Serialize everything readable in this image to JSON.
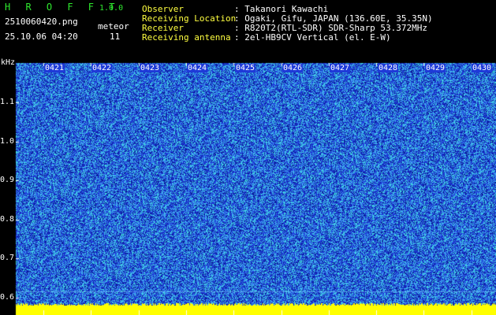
{
  "header": {
    "logo": "H R O F F T",
    "version": "1.0.0",
    "filename": "2510060420.png",
    "datetime": "25.10.06 04:20",
    "meteor_label": "meteor",
    "meteor_count": "11"
  },
  "info": {
    "observer_label": "Observer",
    "observer_value": ": Takanori Kawachi",
    "location_label": "Receiving Location",
    "location_value": ": Ogaki, Gifu, JAPAN (136.60E, 35.35N)",
    "receiver_label": "Receiver",
    "receiver_value": ": R820T2(RTL-SDR) SDR-Sharp 53.372MHz",
    "antenna_label": "Receiving antenna",
    "antenna_value": ": 2el-HB9CV Vertical (el. E-W)"
  },
  "axis": {
    "unit": "kHz",
    "y_ticks": [
      "1.1",
      "1.0",
      "0.9",
      "0.8",
      "0.7",
      "0.6"
    ],
    "y_values": [
      1.1,
      1.0,
      0.9,
      0.8,
      0.7,
      0.6
    ],
    "time_ticks": [
      "0421",
      "0422",
      "0423",
      "0424",
      "0425",
      "0426",
      "0427",
      "0428",
      "0429",
      "0430"
    ]
  },
  "colors": {
    "background": "#000000",
    "spectrogram_base": "#1e3ad8",
    "noise_light": "#3fa0f0",
    "noise_cyan": "#40e0e0",
    "noise_dark": "#0a1a9a",
    "floor_band": "#ffff00",
    "header_green": "#2ee82e",
    "header_yellow": "#ffff40"
  }
}
